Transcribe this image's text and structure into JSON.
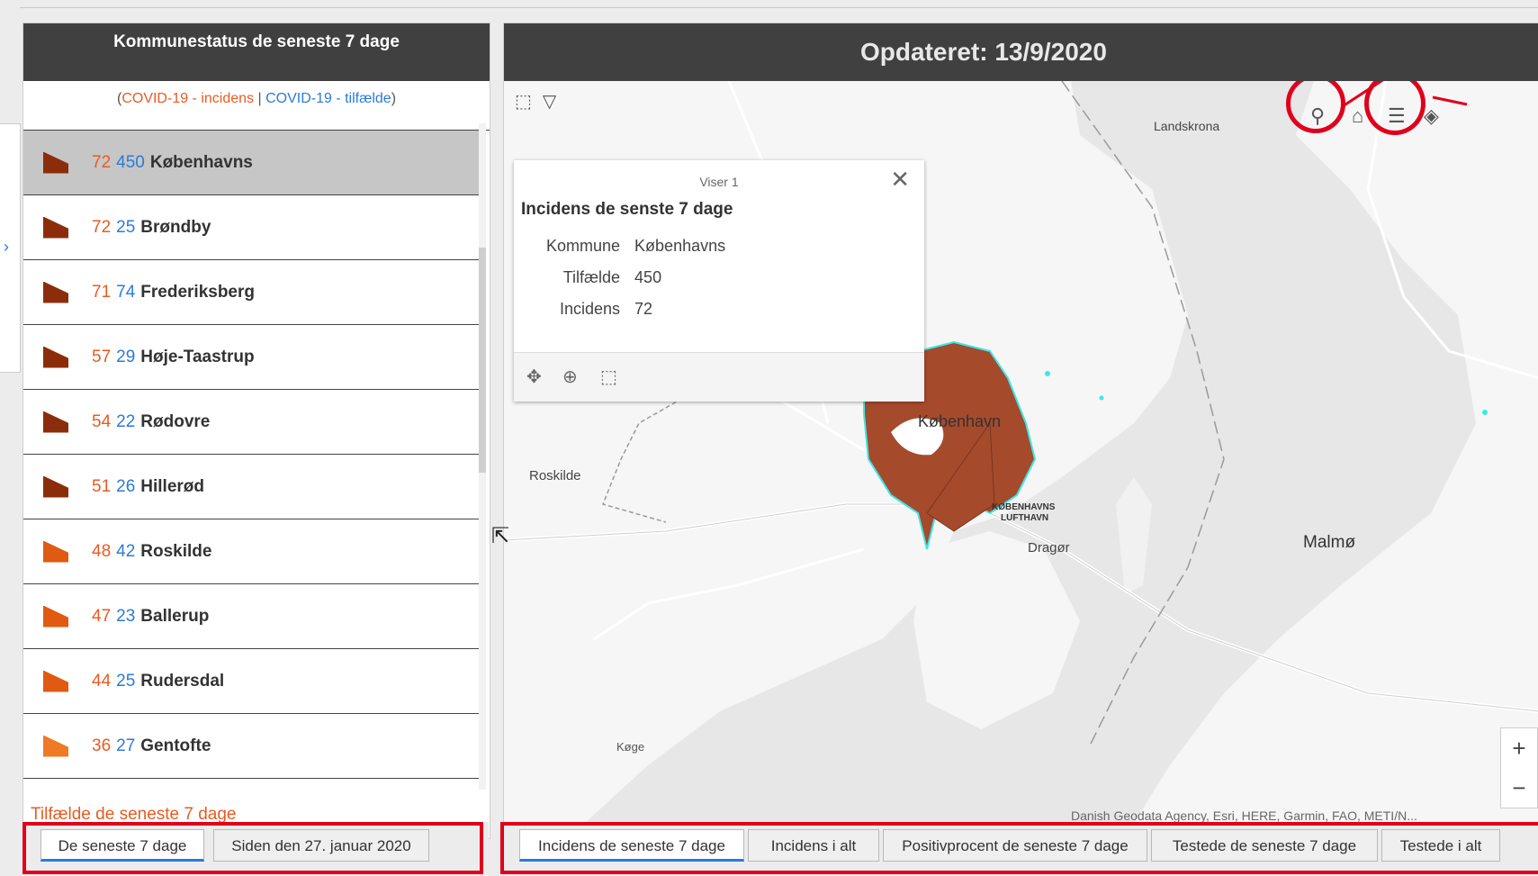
{
  "left_panel": {
    "title": "Kommunestatus de seneste 7 dage",
    "legend_open": "(",
    "legend_incidens": "COVID-19 - incidens",
    "legend_sep": "|",
    "legend_tilfaelde": "COVID-19 - tilfælde",
    "legend_close": ")",
    "rows": [
      {
        "incidens": "72",
        "tilfaelde": "450",
        "kommune": "Københavns",
        "color": "#8b2d0a"
      },
      {
        "incidens": "72",
        "tilfaelde": "25",
        "kommune": "Brøndby",
        "color": "#8b2d0a"
      },
      {
        "incidens": "71",
        "tilfaelde": "74",
        "kommune": "Frederiksberg",
        "color": "#8b2d0a"
      },
      {
        "incidens": "57",
        "tilfaelde": "29",
        "kommune": "Høje-Taastrup",
        "color": "#8b2d0a"
      },
      {
        "incidens": "54",
        "tilfaelde": "22",
        "kommune": "Rødovre",
        "color": "#8b2d0a"
      },
      {
        "incidens": "51",
        "tilfaelde": "26",
        "kommune": "Hillerød",
        "color": "#8b2d0a"
      },
      {
        "incidens": "48",
        "tilfaelde": "42",
        "kommune": "Roskilde",
        "color": "#e05a12"
      },
      {
        "incidens": "47",
        "tilfaelde": "23",
        "kommune": "Ballerup",
        "color": "#e05a12"
      },
      {
        "incidens": "44",
        "tilfaelde": "25",
        "kommune": "Rudersdal",
        "color": "#e05a12"
      },
      {
        "incidens": "36",
        "tilfaelde": "27",
        "kommune": "Gentofte",
        "color": "#f07a24"
      }
    ],
    "footer_text": "Tilfælde de seneste 7 dage"
  },
  "left_tabs": [
    "De seneste 7 dage",
    "Siden den 27. januar 2020"
  ],
  "map": {
    "header": "Opdateret: 13/9/2020",
    "labels": {
      "landskrona": "Landskrona",
      "roskilde": "Roskilde",
      "kobenhavn": "København",
      "airport1": "KØBENHAVNS",
      "airport2": "LUFTHAVN",
      "dragor": "Dragør",
      "malmo": "Malmø",
      "koge": "Køge"
    },
    "popup": {
      "count": "Viser 1",
      "title": "Incidens de senste 7 dage",
      "fields": [
        {
          "key": "Kommune",
          "value": "Københavns"
        },
        {
          "key": "Tilfælde",
          "value": "450"
        },
        {
          "key": "Incidens",
          "value": "72"
        }
      ]
    },
    "attribution": "Danish Geodata Agency, Esri, HERE, Garmin, FAO, METI/N...",
    "zoom_in": "+",
    "zoom_out": "−"
  },
  "map_tabs": [
    "Incidens de seneste 7 dage",
    "Incidens i alt",
    "Positivprocent de seneste 7 dage",
    "Testede de seneste 7 dage",
    "Testede i alt"
  ]
}
